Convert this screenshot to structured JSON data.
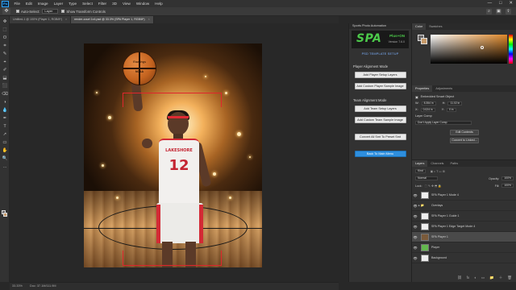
{
  "menu": {
    "items": [
      "File",
      "Edit",
      "Image",
      "Layer",
      "Type",
      "Select",
      "Filter",
      "3D",
      "View",
      "Window",
      "Help"
    ],
    "window_controls": [
      "—",
      "□",
      "✕"
    ]
  },
  "options_bar": {
    "auto_select_label": "Auto-Select:",
    "auto_select_value": "Layer",
    "transform_label": "Show Transform Controls"
  },
  "document_tabs": [
    {
      "label": "Untitled-1 @ 100% (Player 1, RGB/8*)",
      "close": "×"
    },
    {
      "label": "render-court 1x4.psd @ 33.3% (SPA Player 1, RGB/8*)",
      "close": "×"
    }
  ],
  "canvas": {
    "jersey_team": "LAKESHORE",
    "jersey_number": "12",
    "ball_brand": "Rawlings",
    "ball_sub": "NCAA"
  },
  "status_bar": {
    "zoom": "33.33%",
    "doc_info": "Doc: 37.1M/111.9M"
  },
  "plugin": {
    "panel_title": "Sports Photo Automation",
    "logo": "SPA",
    "edition": "Plus+ON",
    "version": "Version 7.6.0",
    "psd_setup": "PSD TEMPLATE SETUP",
    "player_section": "Player Alignment Mode",
    "btn_add_player": "Add Player Setup Layers",
    "btn_add_player_sample": "Add Custom Player Sample Image",
    "team_section": "Team Alignment Mode",
    "btn_add_team": "Add Team Setup Layers",
    "btn_add_team_sample": "Add Custom Team Sample Image",
    "btn_convert": "Convert All Smt To Preset Smt",
    "btn_back": "Back To Main Menu"
  },
  "color_panel": {
    "tabs": [
      "Color",
      "Swatches"
    ],
    "fg": "#6b6868",
    "bg": "#c79a6a"
  },
  "properties_panel": {
    "tabs": [
      "Properties",
      "Adjustments"
    ],
    "object_type": "Embedded Smart Object",
    "w_label": "W:",
    "w_value": "8.354 in",
    "h_label": "H:",
    "h_value": "11.02 in",
    "x_label": "X:",
    "x_value": "0.024 in",
    "y_label": "Y:",
    "y_value": "0 in",
    "comp_label": "Layer Comp",
    "comp_value": "Don't Apply Layer Comp",
    "btn_edit": "Edit Contents",
    "btn_convert": "Convert to Linked..."
  },
  "layers_panel": {
    "tabs": [
      "Layers",
      "Channels",
      "Paths"
    ],
    "filter_kind": "Kind",
    "blend_mode": "Normal",
    "opacity_label": "Opacity:",
    "opacity_value": "100%",
    "lock_label": "Lock:",
    "fill_label": "Fill:",
    "fill_value": "100%",
    "layers": [
      {
        "name": "SPA Player 1 Mode 4",
        "thumb": "light",
        "eye": "👁",
        "selected": false
      },
      {
        "name": "Overlays",
        "thumb": "folder",
        "eye": "👁",
        "selected": false
      },
      {
        "name": "SPA Player 1 Guide 1",
        "thumb": "light",
        "eye": "👁",
        "selected": false
      },
      {
        "name": "SPA Player 1 Edge Target Mode 4",
        "thumb": "light",
        "eye": "👁",
        "selected": false
      },
      {
        "name": "SPA Player 1",
        "thumb": "dark",
        "eye": "👁",
        "selected": true
      },
      {
        "name": "Player",
        "thumb": "green",
        "eye": "👁",
        "selected": false
      },
      {
        "name": "Background",
        "thumb": "light",
        "eye": "👁",
        "selected": false
      }
    ],
    "footer_icons": [
      "⛓",
      "fx",
      "◐",
      "▭",
      "📁",
      "＋",
      "🗑"
    ]
  },
  "tools": [
    "✥",
    "⬚",
    "ʘ",
    "⌗",
    "✎",
    "⌖",
    "✐",
    "⬓",
    "⬛",
    "⌫",
    "◑",
    "💧",
    "✒",
    "T",
    "➚",
    "▭",
    "✋",
    "🔍",
    "…"
  ]
}
